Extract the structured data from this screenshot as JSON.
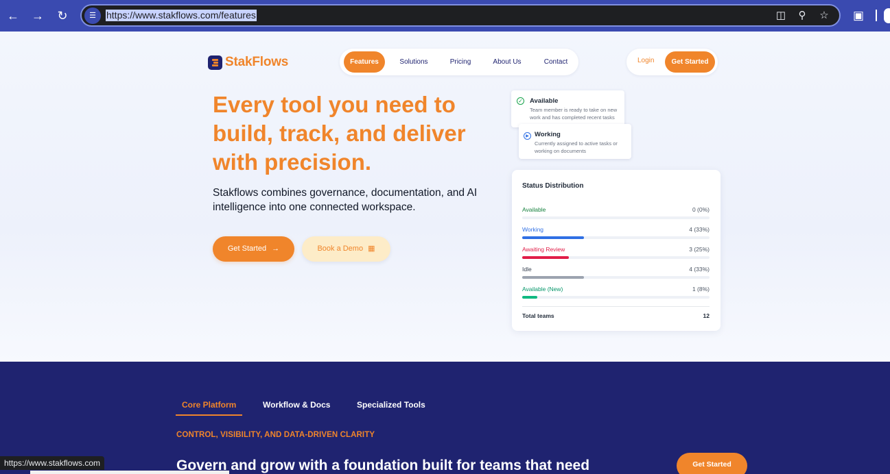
{
  "browser": {
    "url": "https://www.stakflows.com/features",
    "status_url": "https://www.stakflows.com"
  },
  "header": {
    "logo_text": "StakFlows",
    "nav": [
      {
        "label": "Features",
        "active": true
      },
      {
        "label": "Solutions",
        "active": false
      },
      {
        "label": "Pricing",
        "active": false
      },
      {
        "label": "About Us",
        "active": false
      },
      {
        "label": "Contact",
        "active": false
      }
    ],
    "login_label": "Login",
    "cta_label": "Get Started"
  },
  "hero": {
    "headline": "Every tool you need to build, track, and deliver with precision.",
    "subtext": "Stakflows combines governance, documentation, and AI intelligence into one connected workspace.",
    "primary_cta": "Get Started",
    "secondary_cta": "Book a Demo"
  },
  "status_cards": [
    {
      "title": "Available",
      "description": "Team member is ready to take on new work and has completed recent tasks"
    },
    {
      "title": "Working",
      "description": "Currently assigned to active tasks or working on documents"
    }
  ],
  "status_distribution": {
    "title": "Status Distribution",
    "rows": [
      {
        "label": "Available",
        "value": "0 (0%)",
        "percent": 0,
        "color": "#15803d"
      },
      {
        "label": "Working",
        "value": "4 (33%)",
        "percent": 33,
        "color": "#2f6fe4"
      },
      {
        "label": "Awaiting Review",
        "value": "3 (25%)",
        "percent": 25,
        "color": "#e11d48"
      },
      {
        "label": "Idle",
        "value": "4 (33%)",
        "percent": 33,
        "color": "#9ca3af"
      },
      {
        "label": "Available (New)",
        "value": "1 (8%)",
        "percent": 8,
        "color": "#10b981"
      }
    ],
    "total_label": "Total teams",
    "total_value": "12"
  },
  "features": {
    "tabs": [
      {
        "label": "Core Platform",
        "active": true
      },
      {
        "label": "Workflow & Docs",
        "active": false
      },
      {
        "label": "Specialized Tools",
        "active": false
      }
    ],
    "eyebrow": "CONTROL, VISIBILITY, AND DATA-DRIVEN CLARITY",
    "heading": "Govern and grow with a foundation built for teams that need",
    "cta_label": "Get Started"
  },
  "colors": {
    "brand_orange": "#f0852b",
    "brand_navy": "#1f2370"
  }
}
